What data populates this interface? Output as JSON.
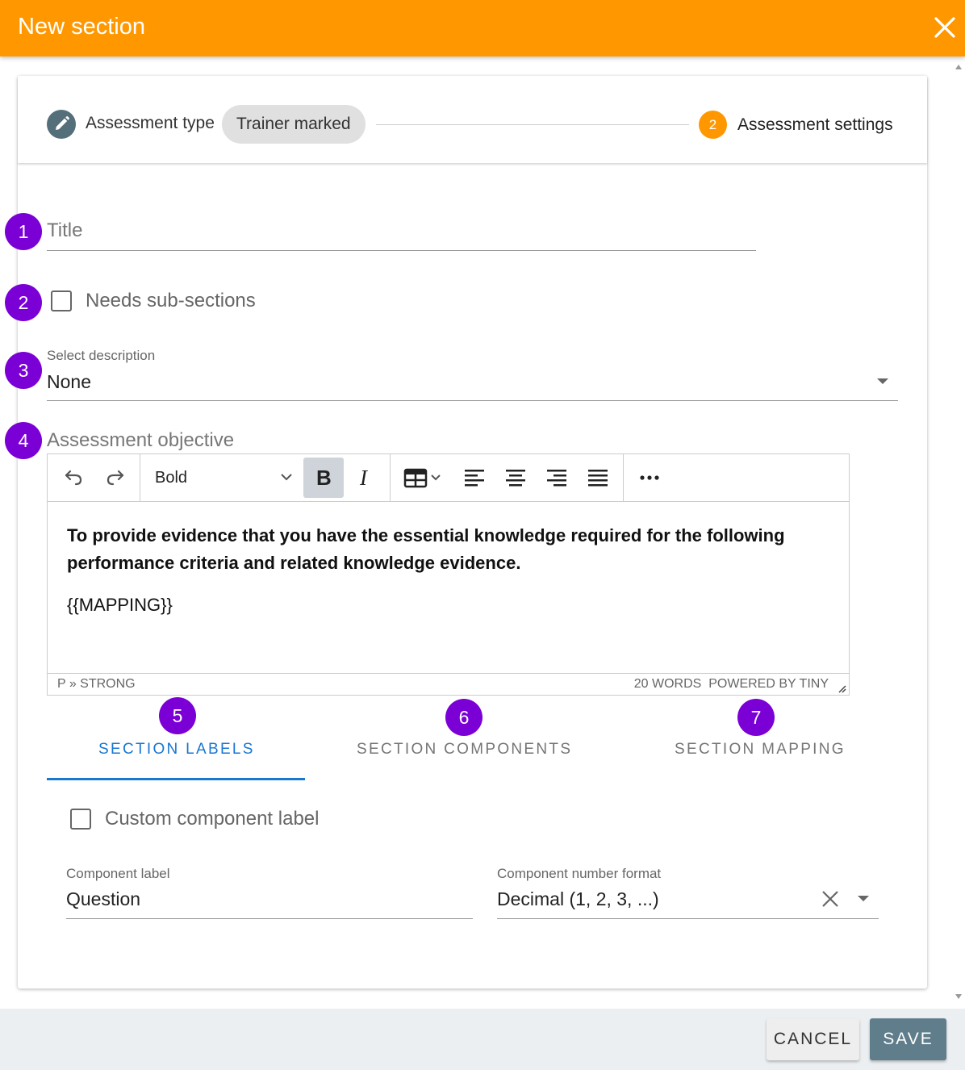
{
  "dialog": {
    "title": "New section"
  },
  "stepper": {
    "step1": {
      "label": "Assessment type",
      "chip": "Trainer marked"
    },
    "step2": {
      "number": "2",
      "label": "Assessment settings"
    }
  },
  "badges": [
    "1",
    "2",
    "3",
    "4",
    "5",
    "6",
    "7"
  ],
  "form": {
    "title_placeholder": "Title",
    "needs_subsections_label": "Needs sub-sections",
    "description_label": "Select description",
    "description_value": "None",
    "objective_label": "Assessment objective"
  },
  "editor": {
    "block_format": "Bold",
    "content_bold": "To provide evidence that you have the essential knowledge required for the following performance criteria and related knowledge evidence.",
    "content_mapping": "{{MAPPING}}",
    "status_path": "P » STRONG",
    "status_words": "20 WORDS",
    "status_powered": "POWERED BY TINY"
  },
  "tabs": [
    {
      "label": "SECTION LABELS",
      "active": true
    },
    {
      "label": "SECTION COMPONENTS",
      "active": false
    },
    {
      "label": "SECTION MAPPING",
      "active": false
    }
  ],
  "section_labels": {
    "custom_label_checkbox": "Custom component label",
    "component_label_caption": "Component label",
    "component_label_value": "Question",
    "number_format_caption": "Component number format",
    "number_format_value": "Decimal (1, 2, 3, ...)"
  },
  "footer": {
    "cancel": "CANCEL",
    "save": "SAVE"
  },
  "colors": {
    "header": "#ff9800",
    "badge": "#7b00d6",
    "active_tab": "#1976d2",
    "save_button": "#607d8b"
  }
}
